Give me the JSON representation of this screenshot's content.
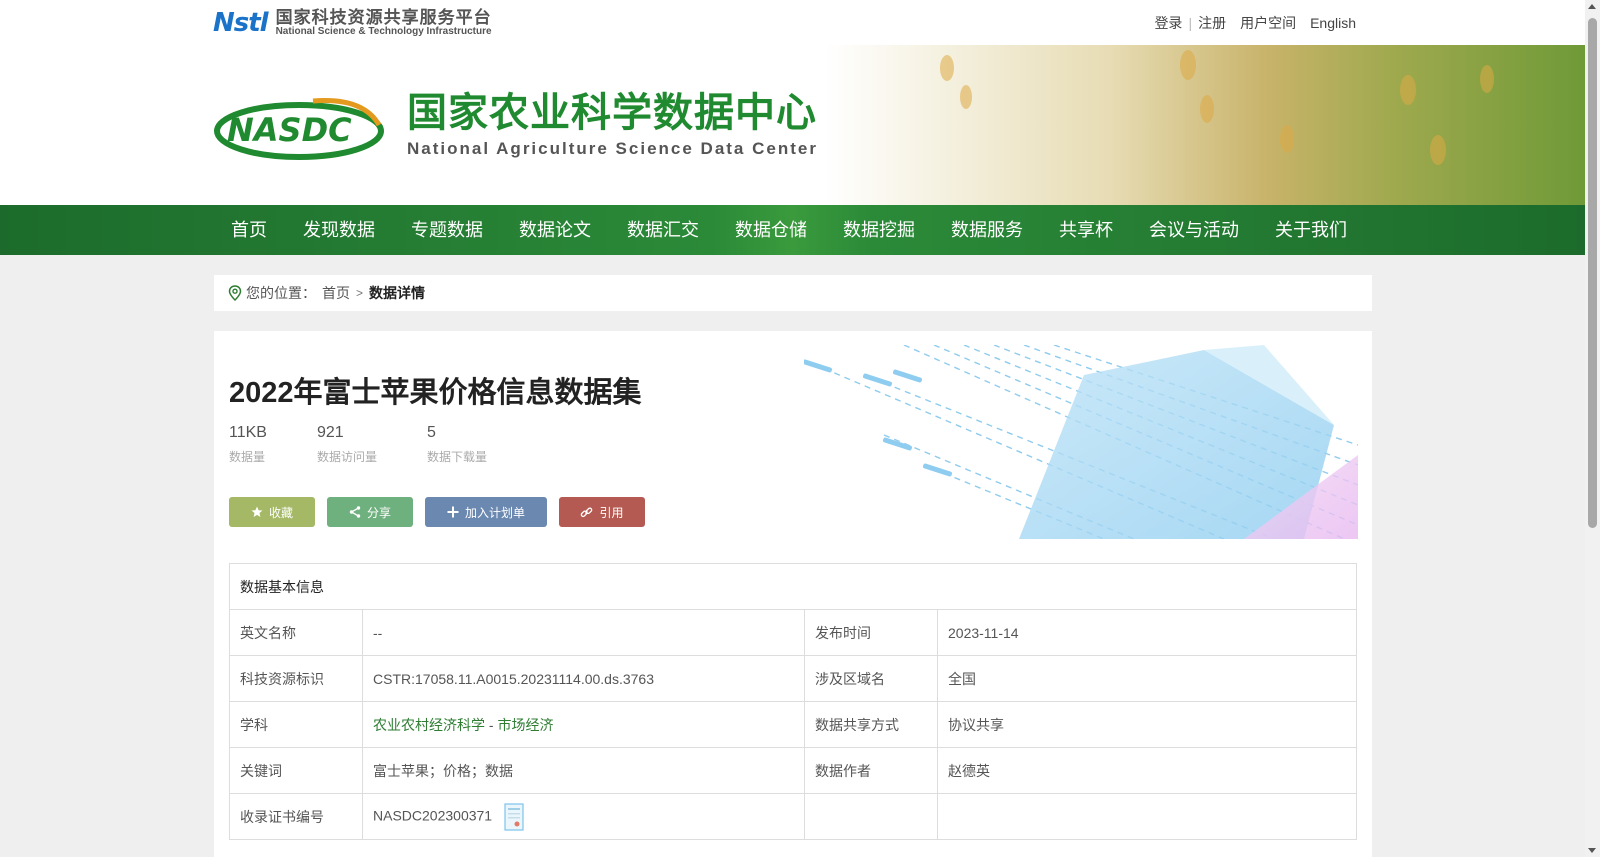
{
  "top": {
    "nstl_mark": "Nstl",
    "nstl_cn": "国家科技资源共享服务平台",
    "nstl_en": "National Science & Technology Infrastructure",
    "links": {
      "login": "登录",
      "register": "注册",
      "user_space": "用户空间",
      "english": "English"
    }
  },
  "header": {
    "title_cn": "国家农业科学数据中心",
    "title_en": "National Agriculture Science Data Center"
  },
  "nav": {
    "items": [
      "首页",
      "发现数据",
      "专题数据",
      "数据论文",
      "数据汇交",
      "数据仓储",
      "数据挖掘",
      "数据服务",
      "共享杯",
      "会议与活动",
      "关于我们"
    ]
  },
  "breadcrumb": {
    "label": "您的位置：",
    "home": "首页",
    "separator": ">",
    "current": "数据详情"
  },
  "dataset": {
    "title": "2022年富士苹果价格信息数据集",
    "stats": [
      {
        "value": "11KB",
        "label": "数据量"
      },
      {
        "value": "921",
        "label": "数据访问量"
      },
      {
        "value": "5",
        "label": "数据下载量"
      }
    ],
    "actions": {
      "favorite": "收藏",
      "share": "分享",
      "add_plan": "加入计划单",
      "cite": "引用"
    }
  },
  "info": {
    "header": "数据基本信息",
    "rows": [
      {
        "k1": "英文名称",
        "v1": "--",
        "k2": "发布时间",
        "v2": "2023-11-14"
      },
      {
        "k1": "科技资源标识",
        "v1": "CSTR:17058.11.A0015.20231114.00.ds.3763",
        "k2": "涉及区域名",
        "v2": "全国"
      },
      {
        "k1": "学科",
        "v1a": "农业农村经济科学",
        "v1sep": " - ",
        "v1b": "市场经济",
        "k2": "数据共享方式",
        "v2": "协议共享"
      },
      {
        "k1": "关键词",
        "v1": "富士苹果；价格；数据",
        "k2": "数据作者",
        "v2": "赵德英"
      },
      {
        "k1": "收录证书编号",
        "v1": "NASDC202300371",
        "k2": "",
        "v2": ""
      }
    ]
  },
  "colors": {
    "nav_green": "#2b8a38",
    "brand_green": "#1f8a2f",
    "link_green": "#2e7d32"
  }
}
